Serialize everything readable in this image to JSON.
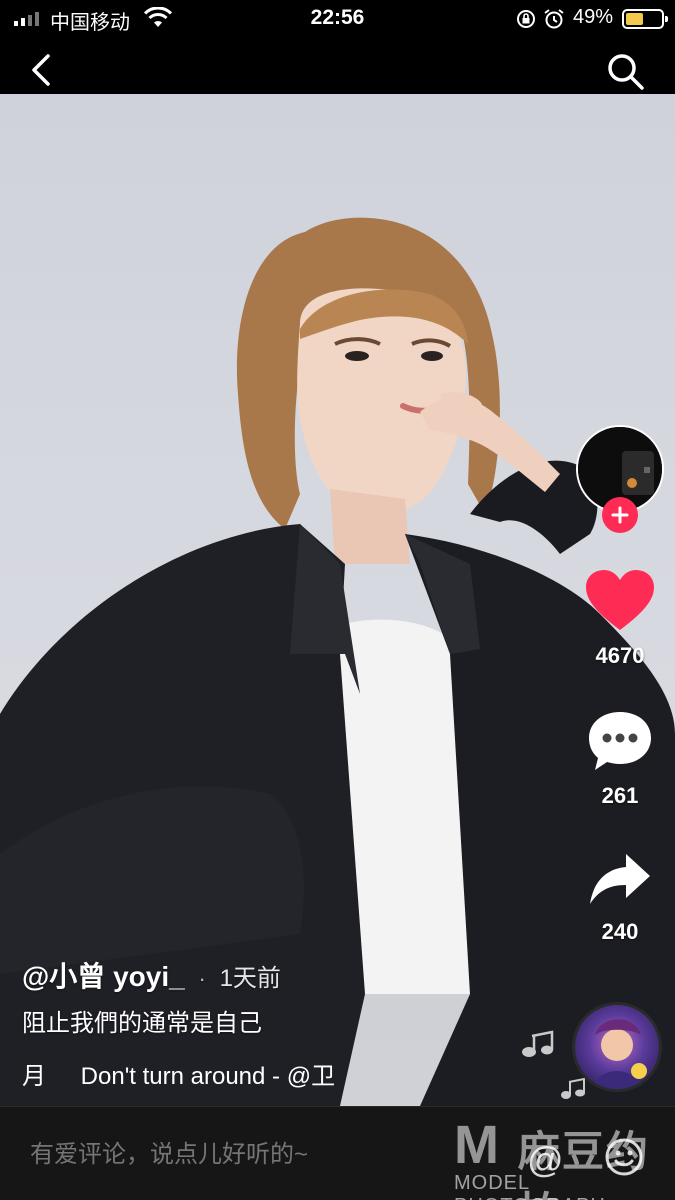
{
  "status_bar": {
    "carrier": "中国移动",
    "time": "22:56",
    "battery_percent": "49%",
    "battery_level": 0.49,
    "icons": [
      "signal-icon",
      "wifi-icon",
      "orientation-lock-icon",
      "alarm-icon",
      "battery-icon"
    ]
  },
  "nav": {
    "icons": [
      "back-icon",
      "search-icon"
    ]
  },
  "video": {
    "author": "@小曾 yoyi_",
    "separator": "·",
    "posted": "1天前",
    "description": "阻止我們的通常是自己",
    "music_glyph": "月",
    "music": "Don't turn around - @卫"
  },
  "actions": {
    "likes": "4670",
    "comments": "261",
    "shares": "240",
    "like_color": "#fe2c55",
    "follow_color": "#fe2c55"
  },
  "comment_bar": {
    "placeholder": "有爱评论，说点儿好听的~",
    "at_symbol": "@"
  },
  "watermark": {
    "letter": "M",
    "brand_cn": "麻豆约拍",
    "brand_en": "MODEL PHOTOGRAPH"
  }
}
